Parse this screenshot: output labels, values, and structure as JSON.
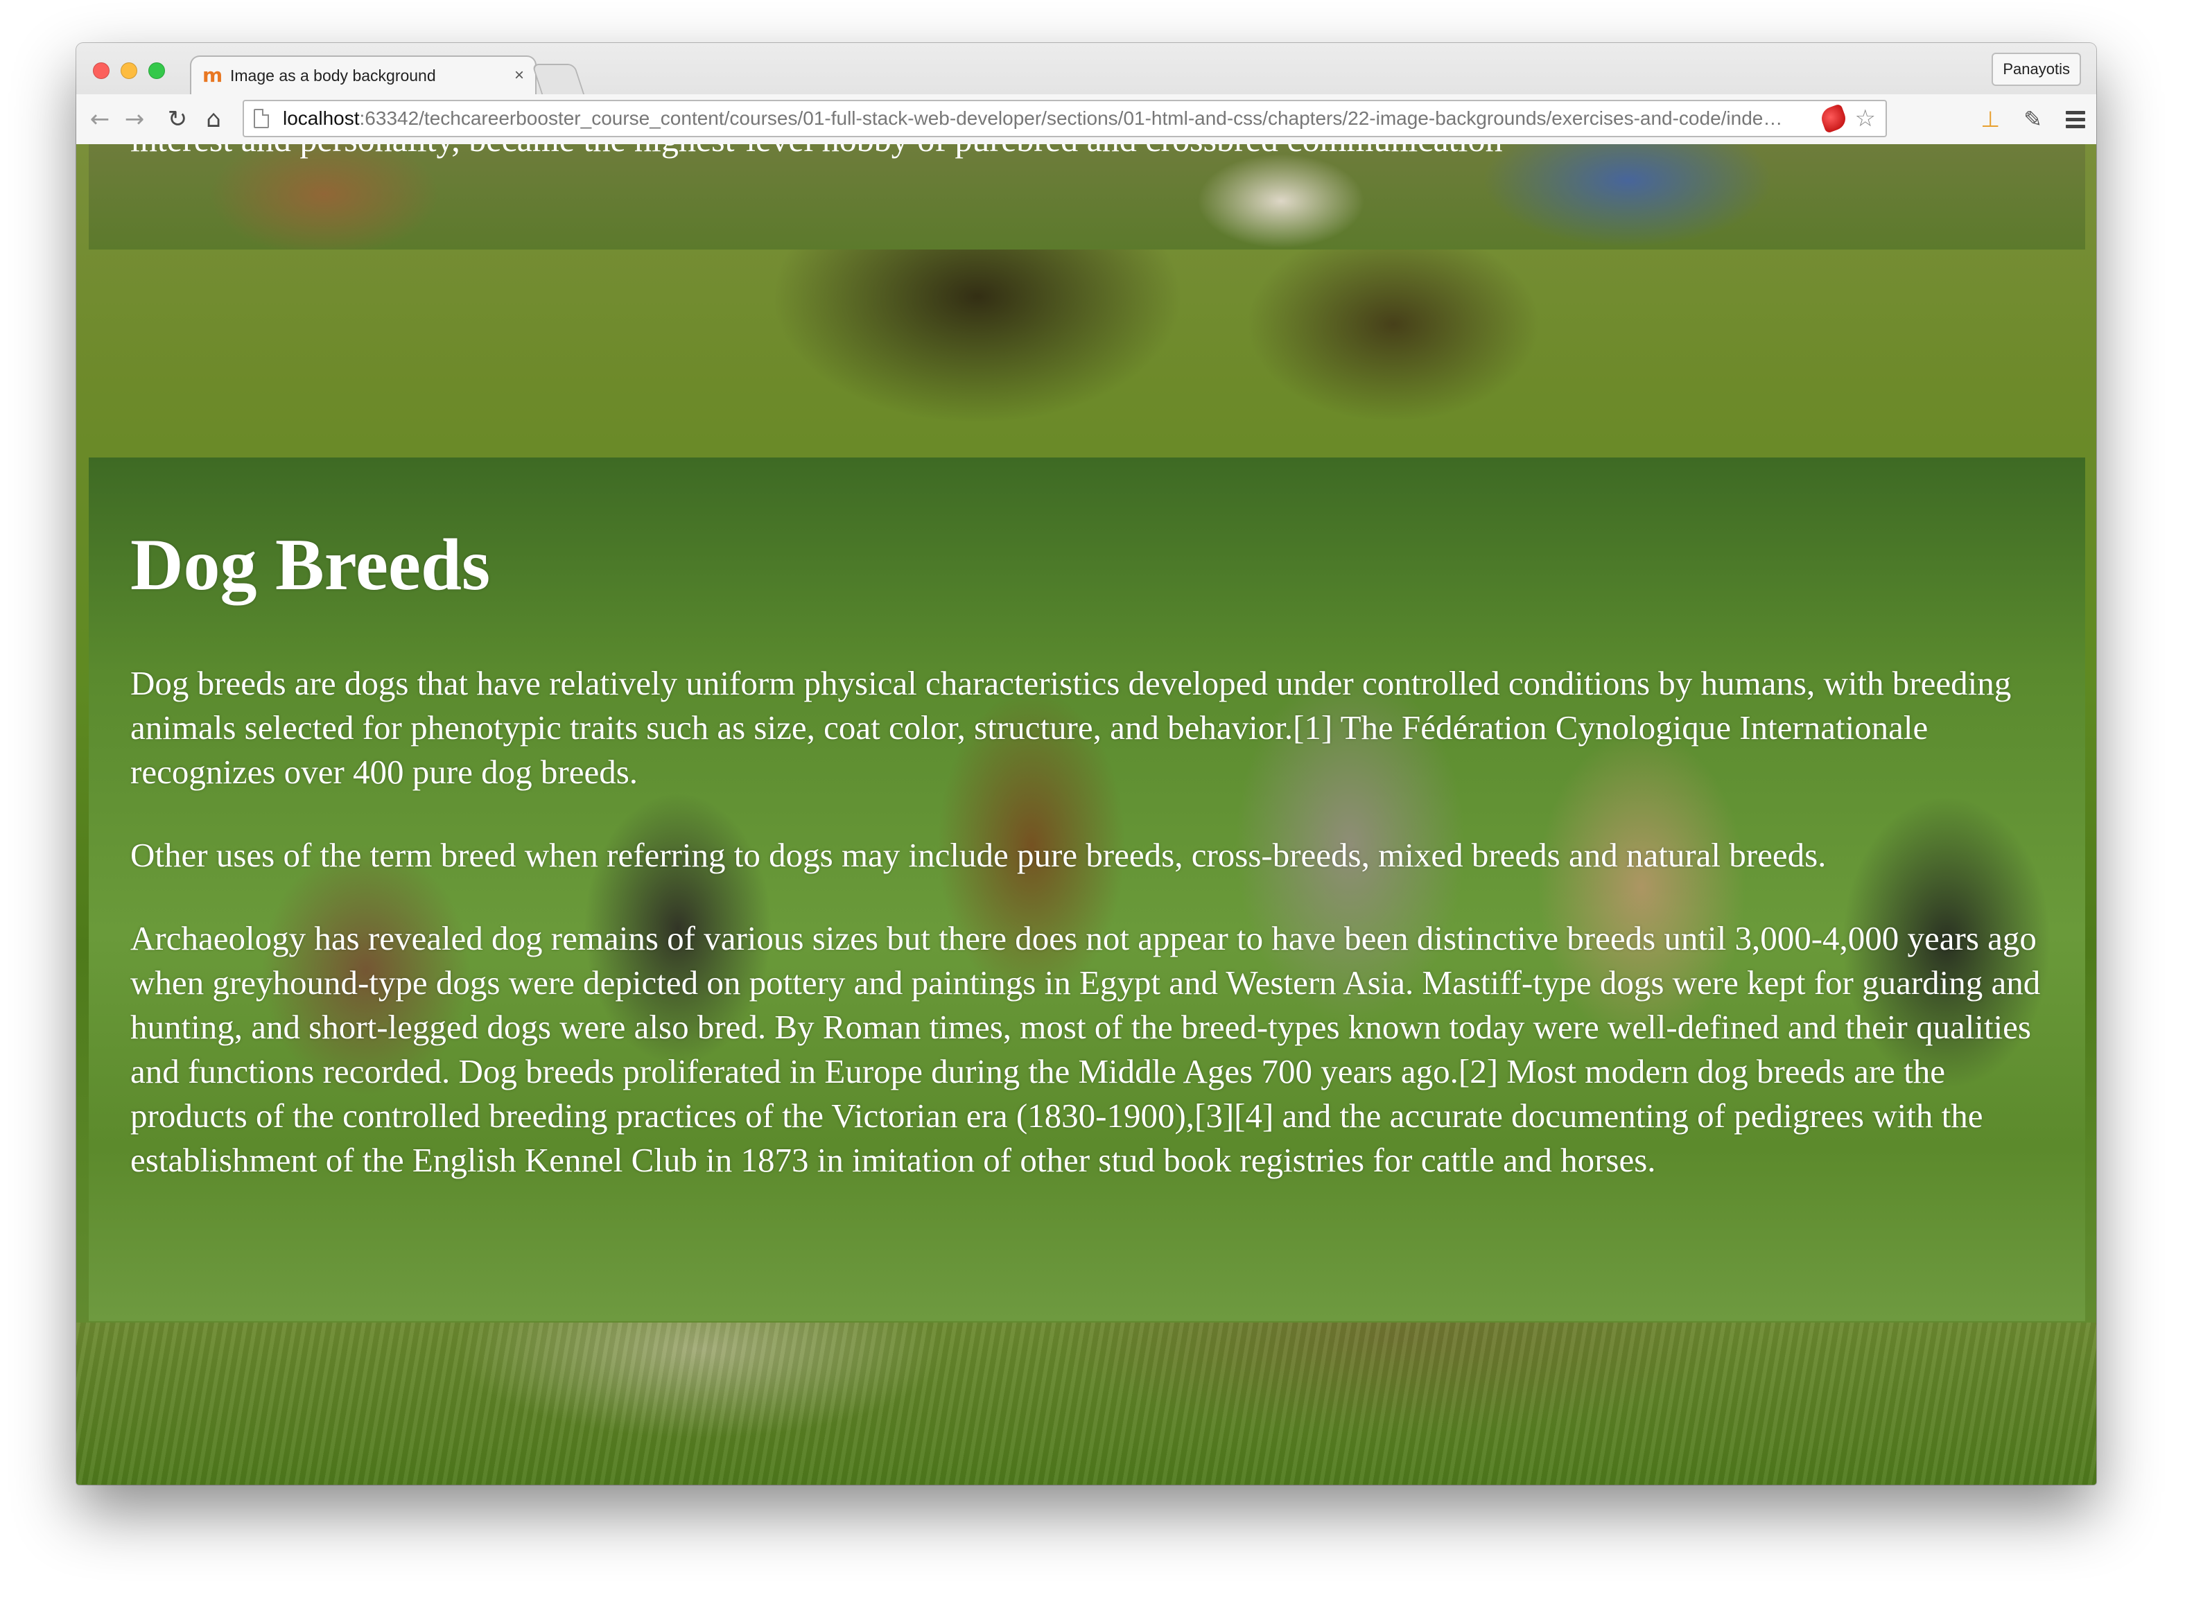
{
  "browser": {
    "tab_title": "Image as a body background",
    "tab_close": "×",
    "profile_name": "Panayotis",
    "url_host": "localhost",
    "url_rest": ":63342/techcareerbooster_course_content/courses/01-full-stack-web-developer/sections/01-html-and-css/chapters/22-image-backgrounds/exercises-and-code/inde…",
    "nav": {
      "back": "←",
      "forward": "→",
      "reload": "↻",
      "home": "⌂"
    },
    "star": "☆"
  },
  "page": {
    "cut_text": "interest and personality, became the highest-level hobby of purebred and crossbred communication",
    "heading": "Dog Breeds",
    "paragraphs": [
      "Dog breeds are dogs that have relatively uniform physical characteristics developed under controlled conditions by humans, with breeding animals selected for phenotypic traits such as size, coat color, structure, and behavior.[1] The Fédération Cynologique Internationale recognizes over 400 pure dog breeds.",
      "Other uses of the term breed when referring to dogs may include pure breeds, cross-breeds, mixed breeds and natural breeds.",
      "Archaeology has revealed dog remains of various sizes but there does not appear to have been distinctive breeds until 3,000-4,000 years ago when greyhound-type dogs were depicted on pottery and paintings in Egypt and Western Asia. Mastiff-type dogs were kept for guarding and hunting, and short-legged dogs were also bred. By Roman times, most of the breed-types known today were well-defined and their qualities and functions recorded. Dog breeds proliferated in Europe during the Middle Ages 700 years ago.[2] Most modern dog breeds are the products of the controlled breeding practices of the Victorian era (1830-1900),[3][4] and the accurate documenting of pedigrees with the establishment of the English Kennel Club in 1873 in imitation of other stud book registries for cattle and horses."
    ]
  },
  "icons": [
    "favicon-icon",
    "close-icon",
    "back-icon",
    "forward-icon",
    "reload-icon",
    "home-icon",
    "page-icon",
    "extension-icon",
    "star-icon",
    "bookmark-icon",
    "tools-icon",
    "menu-icon"
  ],
  "colors": {
    "text": "#ffffff",
    "grass": "#5a8a2e",
    "chrome": "#ececec"
  }
}
